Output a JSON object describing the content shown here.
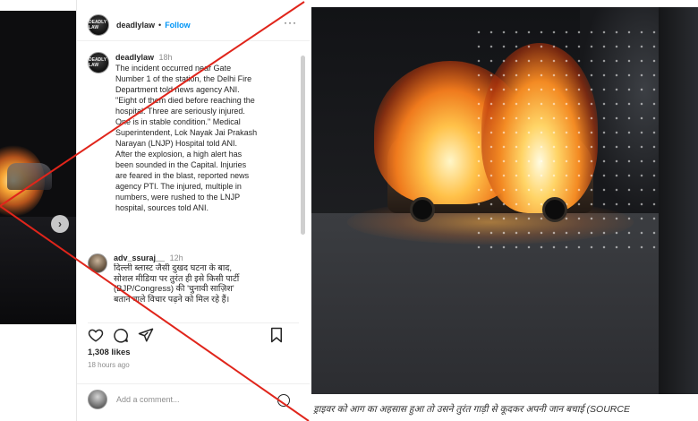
{
  "post": {
    "username": "deadlylaw",
    "avatar_text": "DEADLY LAW",
    "follow_label": "Follow",
    "more_label": "···",
    "caption_time": "18h",
    "caption_text": "The incident occurred near Gate\nNumber 1 of the station, the Delhi Fire\nDepartment told news agency ANI.\n\"Eight of them died before reaching the\nhospital. Three are seriously injured.\nOne is in stable condition.\" Medical\nSuperintendent, Lok Nayak Jai Prakash\nNarayan (LNJP) Hospital told ANI.\nAfter the explosion, a high alert has\nbeen sounded in the Capital. Injuries\nare feared in the blast, reported news\nagency PTI. The injured, multiple in\nnumbers, were rushed to the LNJP\nhospital, sources told ANI.",
    "comment": {
      "username": "adv_ssuraj__",
      "time": "12h",
      "text": "दिल्ली ब्लास्ट जैसी दुखद घटना के बाद,\nसोशल मीडिया पर तुरंत ही इसे किसी पार्टी\n(BJP/Congress) की 'चुनावी साज़िश'\nबताने वाले विचार पढ़ने को मिल रहे हैं।"
    },
    "likes": "1,308 likes",
    "ago": "18 hours ago",
    "add_comment_placeholder": "Add a comment..."
  },
  "carousel": {
    "next_label": "›"
  },
  "right_caption": "ड्राइवर को आग का अहसास हुआ तो उसने तुरंत गाड़ी से कूदकर अपनी जान बचाई (SOURCE",
  "colors": {
    "follow": "#0095f6",
    "cross": "#e0251b",
    "text": "#262626",
    "muted": "#8e8e8e"
  },
  "icons": [
    "chevron-right-icon",
    "heart-icon",
    "comment-icon",
    "share-icon",
    "bookmark-icon",
    "emoji-icon",
    "more-icon"
  ]
}
